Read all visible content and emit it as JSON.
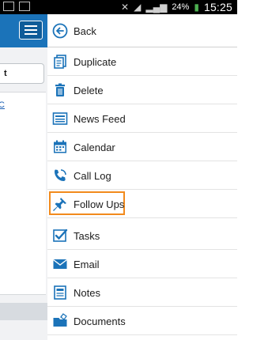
{
  "status_bar": {
    "battery": "24%",
    "time": "15:25"
  },
  "left_panel": {
    "button_label": "t",
    "link_text": "C"
  },
  "menu": {
    "items": [
      {
        "label": "Back",
        "icon": "back-arrow-icon"
      },
      {
        "label": "Duplicate",
        "icon": "duplicate-icon"
      },
      {
        "label": "Delete",
        "icon": "trash-icon"
      },
      {
        "label": "News Feed",
        "icon": "newsfeed-icon"
      },
      {
        "label": "Calendar",
        "icon": "calendar-icon"
      },
      {
        "label": "Call Log",
        "icon": "phone-icon"
      },
      {
        "label": "Follow Ups",
        "icon": "pushpin-icon"
      },
      {
        "label": "Tasks",
        "icon": "checkbox-icon"
      },
      {
        "label": "Email",
        "icon": "envelope-icon"
      },
      {
        "label": "Notes",
        "icon": "notes-icon"
      },
      {
        "label": "Documents",
        "icon": "folder-icon"
      }
    ]
  },
  "colors": {
    "accent": "#1b73b9",
    "highlight": "#f28a1c"
  }
}
